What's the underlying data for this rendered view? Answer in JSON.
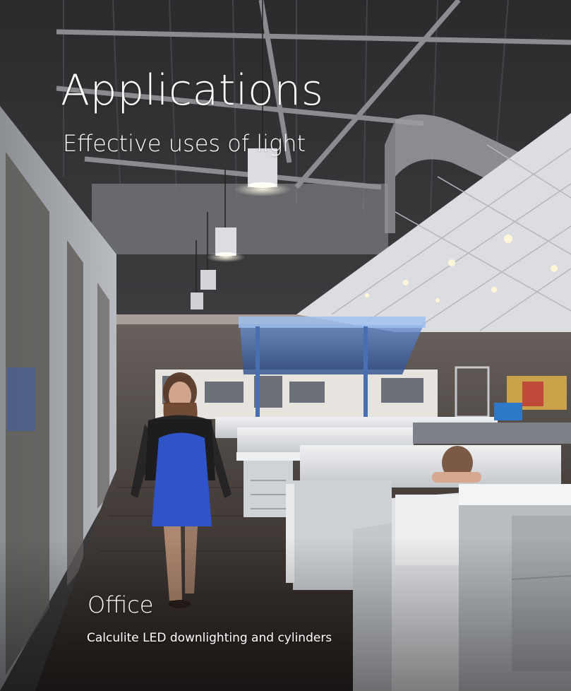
{
  "page": {
    "title": "Applications",
    "subtitle": "Effective uses of light"
  },
  "application": {
    "name": "Office",
    "description": "Calculite LED downlighting and cylinders"
  },
  "colors": {
    "text": "#ffffff",
    "ceiling": "#2c2c2e",
    "wall": "#5a5552",
    "floor": "#3b3633",
    "cubicle": "#d8dadd",
    "accent_blue": "#2f5bd0"
  }
}
